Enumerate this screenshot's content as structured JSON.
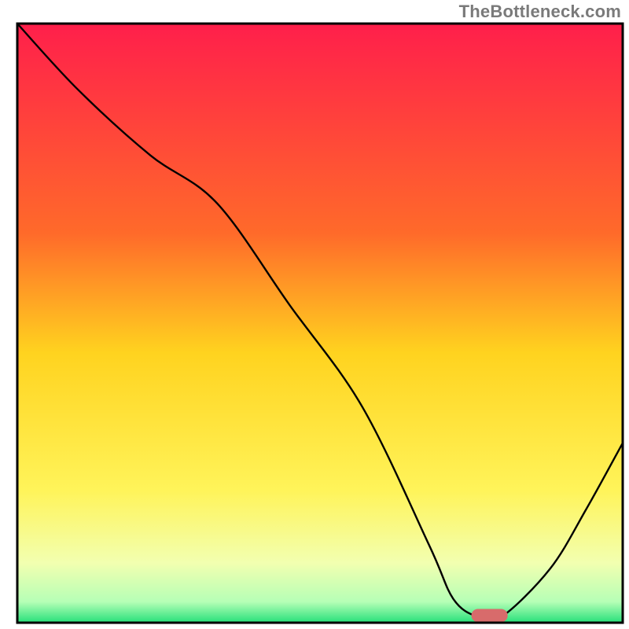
{
  "watermark": "TheBottleneck.com",
  "chart_data": {
    "type": "line",
    "title": "",
    "xlabel": "",
    "ylabel": "",
    "xlim": [
      0,
      100
    ],
    "ylim": [
      0,
      100
    ],
    "background_gradient_stops": [
      {
        "offset": 0,
        "color": "#ff1f4b"
      },
      {
        "offset": 0.35,
        "color": "#ff6a2a"
      },
      {
        "offset": 0.55,
        "color": "#ffd31f"
      },
      {
        "offset": 0.78,
        "color": "#fff45a"
      },
      {
        "offset": 0.9,
        "color": "#f2ffb0"
      },
      {
        "offset": 0.965,
        "color": "#b6ffb6"
      },
      {
        "offset": 1.0,
        "color": "#26e07a"
      }
    ],
    "series": [
      {
        "name": "bottleneck-curve",
        "x": [
          0,
          10,
          22,
          33,
          45,
          57,
          68,
          72,
          76,
          80,
          88,
          94,
          100
        ],
        "values": [
          100,
          89,
          78,
          70,
          53,
          36,
          13,
          4,
          1,
          1,
          9,
          19,
          30
        ]
      }
    ],
    "marker": {
      "name": "optimal-marker",
      "x": 78,
      "y": 1.2,
      "color": "#d86b6b",
      "width": 6,
      "height": 2.2
    },
    "grid": false,
    "legend": false
  }
}
